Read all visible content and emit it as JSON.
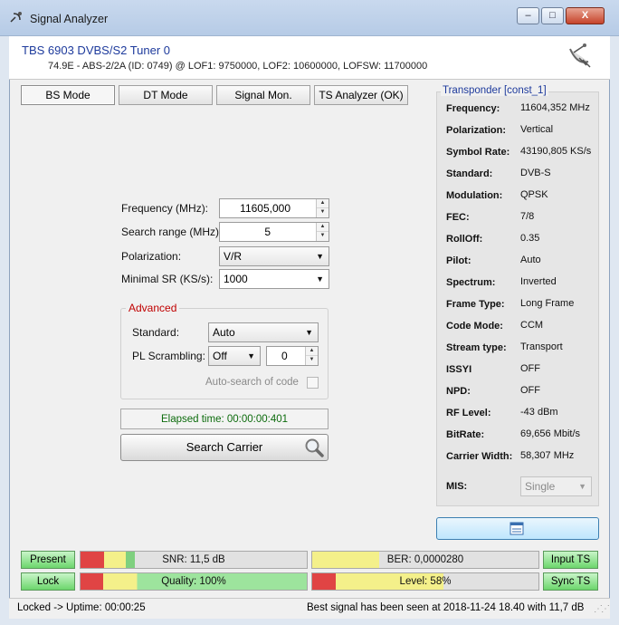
{
  "window": {
    "title": "Signal Analyzer",
    "icon": "satellite-dish-icon"
  },
  "controls": {
    "minimize": "–",
    "maximize": "□",
    "close": "X"
  },
  "header": {
    "title": "TBS 6903 DVBS/S2 Tuner 0",
    "subtitle": "74.9E - ABS-2/2A (ID: 0749) @ LOF1: 9750000, LOF2: 10600000, LOFSW: 11700000"
  },
  "tabs": [
    {
      "label": "BS Mode"
    },
    {
      "label": "DT Mode"
    },
    {
      "label": "Signal Mon."
    },
    {
      "label": "TS Analyzer (OK)"
    }
  ],
  "form": {
    "frequency_label": "Frequency (MHz):",
    "frequency_value": "11605,000",
    "search_range_label": "Search range (MHz):",
    "search_range_value": "5",
    "polarization_label": "Polarization:",
    "polarization_value": "V/R",
    "minimal_sr_label": "Minimal SR (KS/s):",
    "minimal_sr_value": "1000"
  },
  "advanced": {
    "title": "Advanced",
    "standard_label": "Standard:",
    "standard_value": "Auto",
    "pl_label": "PL Scrambling:",
    "pl_value": "Off",
    "pl_code": "0",
    "auto_search_label": "Auto-search of code"
  },
  "elapsed": "Elapsed time: 00:00:00:401",
  "search_button": "Search Carrier",
  "transponder": {
    "title": "Transponder [const_1]",
    "rows": [
      {
        "key": "Frequency:",
        "value": "11604,352 MHz"
      },
      {
        "key": "Polarization:",
        "value": "Vertical"
      },
      {
        "key": "Symbol Rate:",
        "value": "43190,805 KS/s"
      },
      {
        "key": "Standard:",
        "value": "DVB-S"
      },
      {
        "key": "Modulation:",
        "value": "QPSK"
      },
      {
        "key": "FEC:",
        "value": "7/8"
      },
      {
        "key": "RollOff:",
        "value": "0.35"
      },
      {
        "key": "Pilot:",
        "value": "Auto"
      },
      {
        "key": "Spectrum:",
        "value": "Inverted"
      },
      {
        "key": "Frame Type:",
        "value": "Long Frame"
      },
      {
        "key": "Code Mode:",
        "value": "CCM"
      },
      {
        "key": "Stream type:",
        "value": "Transport"
      },
      {
        "key": "ISSYI",
        "value": "OFF"
      },
      {
        "key": "NPD:",
        "value": "OFF"
      },
      {
        "key": "RF Level:",
        "value": "-43 dBm"
      },
      {
        "key": "BitRate:",
        "value": "69,656 Mbit/s"
      },
      {
        "key": "Carrier Width:",
        "value": "58,307 MHz"
      }
    ],
    "mis_label": "MIS:",
    "mis_value": "Single"
  },
  "meters": {
    "present": "Present",
    "lock": "Lock",
    "input_ts": "Input TS",
    "sync_ts": "Sync TS",
    "snr": "SNR: 11,5 dB",
    "ber": "BER: 0,0000280",
    "quality": "Quality: 100%",
    "level": "Level: 58%",
    "quality_fraction": 1.0,
    "level_fraction": 0.58
  },
  "statusbar": {
    "left": "Locked -> Uptime: 00:00:25",
    "right": "Best signal has been seen at 2018-11-24 18.40 with 11,7 dB"
  }
}
